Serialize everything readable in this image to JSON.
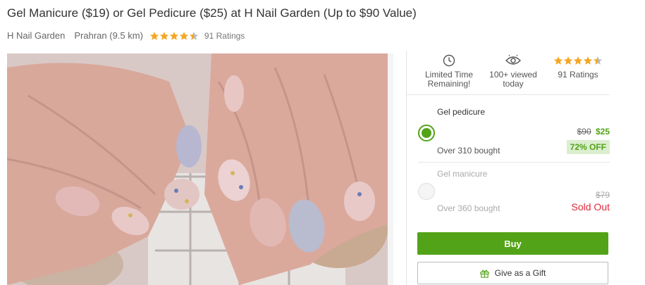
{
  "deal": {
    "title": "Gel Manicure ($19) or Gel Pedicure ($25) at H Nail Garden (Up to $90 Value)",
    "merchant": "H Nail Garden",
    "location": "Prahran (9.5 km)",
    "rating": 4.5,
    "ratings_text": "91 Ratings"
  },
  "features": [
    {
      "icon": "clock-icon",
      "label": "Limited Time Remaining!"
    },
    {
      "icon": "eye-icon",
      "label": "100+ viewed today"
    },
    {
      "icon": "star-rating-icon",
      "label": "91 Ratings"
    }
  ],
  "options": [
    {
      "name": "Gel pedicure",
      "old_price": "$90",
      "new_price": "$25",
      "bought": "Over 310 bought",
      "discount": "72% OFF",
      "selected": true
    },
    {
      "name": "Gel manicure",
      "old_price": "$79",
      "bought": "Over 360 bought",
      "status": "Sold Out",
      "selected": false
    }
  ],
  "buttons": {
    "buy": "Buy",
    "gift": "Give as a Gift"
  },
  "colors": {
    "accent": "#53a318",
    "sold_out": "#e0293b",
    "star": "#f5a623"
  },
  "image": {
    "subject": "nail-art-photo"
  }
}
